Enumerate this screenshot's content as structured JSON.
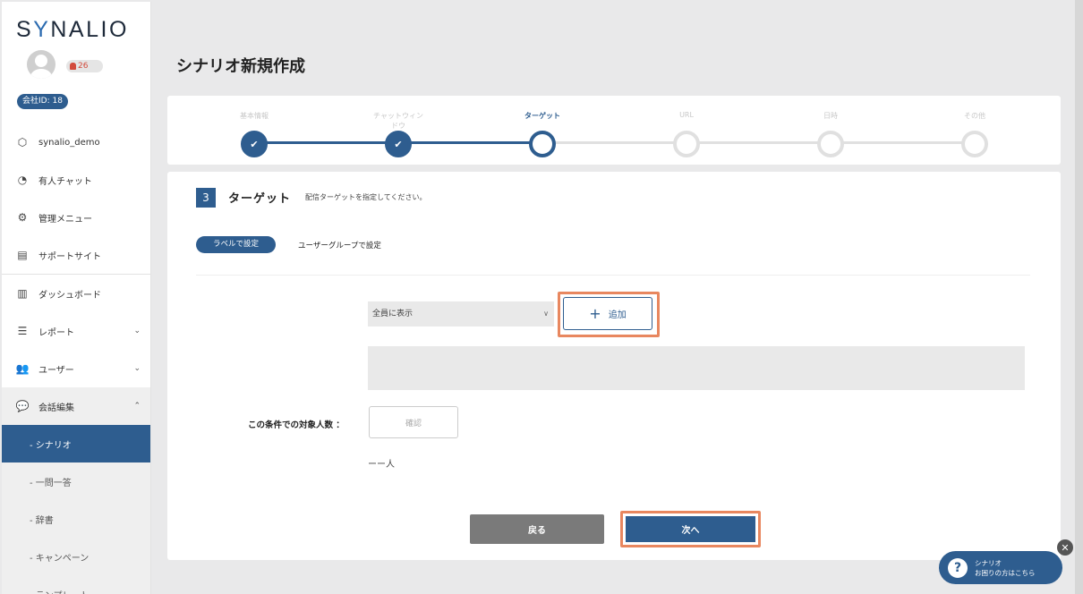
{
  "sidebar": {
    "logo": {
      "pre": "S",
      "y": "Y",
      "post": "NALIO"
    },
    "notifications": "26",
    "company_id": "会社ID: 18",
    "top_items": [
      {
        "label": "synalio_demo",
        "icon": "cube-icon"
      },
      {
        "label": "有人チャット",
        "icon": "headset-icon"
      },
      {
        "label": "管理メニュー",
        "icon": "gears-icon"
      },
      {
        "label": "サポートサイト",
        "icon": "browser-window-icon"
      }
    ],
    "items": [
      {
        "label": "ダッシュボード",
        "icon": "bar-chart-icon"
      },
      {
        "label": "レポート",
        "icon": "list-icon",
        "chevron": "⌄"
      },
      {
        "label": "ユーザー",
        "icon": "users-icon",
        "chevron": "⌄"
      },
      {
        "label": "会話編集",
        "icon": "chat-bubbles-icon",
        "chevron": "⌃"
      }
    ],
    "sub_items": [
      {
        "label": "- シナリオ",
        "active": true
      },
      {
        "label": "- 一問一答",
        "active": false
      },
      {
        "label": "- 辞書",
        "active": false
      },
      {
        "label": "- キャンペーン",
        "active": false
      },
      {
        "label": "- テンプレート",
        "active": false
      }
    ]
  },
  "page_title": "シナリオ新規作成",
  "steps": [
    {
      "label": "基本情報",
      "state": "done"
    },
    {
      "label": "チャットウィンドウ",
      "state": "done"
    },
    {
      "label": "ターゲット",
      "state": "current"
    },
    {
      "label": "URL",
      "state": "todo"
    },
    {
      "label": "日時",
      "state": "todo"
    },
    {
      "label": "その他",
      "state": "todo"
    }
  ],
  "section": {
    "number": "3",
    "title": "ターゲット",
    "description": "配信ターゲットを指定してください。",
    "tabs": {
      "active": "ラベルで設定",
      "inactive": "ユーザーグループで設定"
    },
    "select_value": "全員に表示",
    "add_label": "追加",
    "count_label": "この条件での対象人数 ：",
    "confirm_label": "確認",
    "count_value": "ーー人",
    "back_label": "戻る",
    "next_label": "次へ"
  },
  "help": {
    "line1": "シナリオ",
    "line2": "お困りの方はこちら"
  },
  "colors": {
    "primary": "#2e5d8f",
    "highlight": "#e8875f",
    "back_button": "#7a7a7a"
  }
}
